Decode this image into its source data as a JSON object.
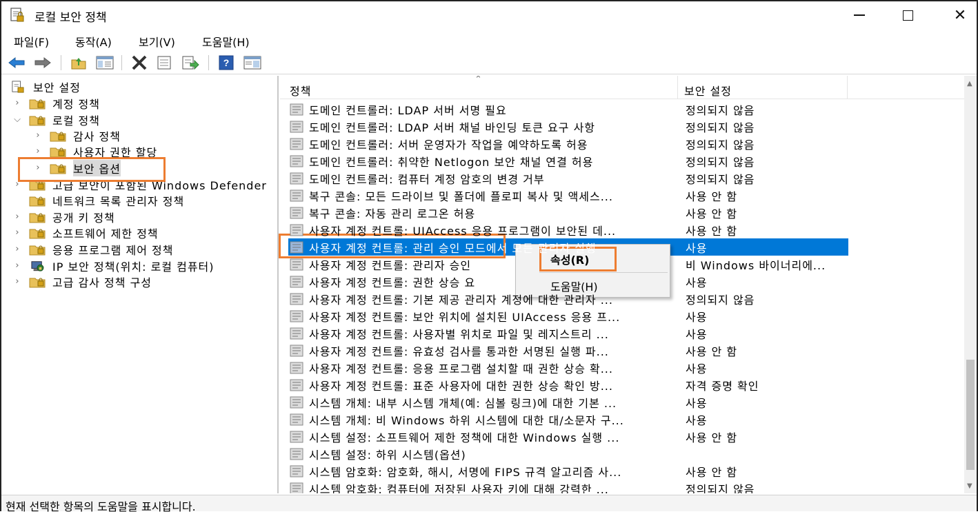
{
  "window": {
    "title": "로컬 보안 정책"
  },
  "menu": [
    "파일(F)",
    "동작(A)",
    "보기(V)",
    "도움말(H)"
  ],
  "toolbar": {
    "icons": [
      "back-arrow-icon",
      "forward-arrow-icon",
      "up-folder-icon",
      "show-hide-tree-icon",
      "delete-icon",
      "properties-icon",
      "export-list-icon",
      "help-icon",
      "console-icon"
    ]
  },
  "tree": [
    {
      "label": "보안 설정",
      "level": 0,
      "chevron": "",
      "icon": "security-settings-icon"
    },
    {
      "label": "계정 정책",
      "level": 1,
      "chevron": ">",
      "icon": "folder-icon"
    },
    {
      "label": "로컬 정책",
      "level": 1,
      "chevron": "v",
      "icon": "folder-icon"
    },
    {
      "label": "감사 정책",
      "level": 2,
      "chevron": ">",
      "icon": "folder-icon"
    },
    {
      "label": "사용자 권한 할당",
      "level": 2,
      "chevron": ">",
      "icon": "folder-icon"
    },
    {
      "label": "보안 옵션",
      "level": 2,
      "chevron": ">",
      "icon": "folder-icon",
      "selected": true
    },
    {
      "label": "고급 보안이 포함된 Windows Defender",
      "level": 1,
      "chevron": ">",
      "icon": "folder-icon"
    },
    {
      "label": "네트워크 목록 관리자 정책",
      "level": 1,
      "chevron": "",
      "icon": "folder-icon"
    },
    {
      "label": "공개 키 정책",
      "level": 1,
      "chevron": ">",
      "icon": "folder-icon"
    },
    {
      "label": "소프트웨어 제한 정책",
      "level": 1,
      "chevron": ">",
      "icon": "folder-icon"
    },
    {
      "label": "응용 프로그램 제어 정책",
      "level": 1,
      "chevron": ">",
      "icon": "folder-icon"
    },
    {
      "label": "IP 보안 정책(위치: 로컬 컴퓨터)",
      "level": 1,
      "chevron": ">",
      "icon": "ip-security-icon"
    },
    {
      "label": "고급 감사 정책 구성",
      "level": 1,
      "chevron": ">",
      "icon": "folder-icon"
    }
  ],
  "list": {
    "columns": {
      "policy": "정책",
      "setting": "보안 설정"
    },
    "rows": [
      {
        "policy": "도메인 컨트롤러: LDAP 서버 서명 필요",
        "setting": "정의되지 않음"
      },
      {
        "policy": "도메인 컨트롤러: LDAP 서버 채널 바인딩 토큰 요구 사항",
        "setting": "정의되지 않음"
      },
      {
        "policy": "도메인 컨트롤러: 서버 운영자가 작업을 예약하도록 허용",
        "setting": "정의되지 않음"
      },
      {
        "policy": "도메인 컨트롤러: 취약한 Netlogon 보안 채널 연결 허용",
        "setting": "정의되지 않음"
      },
      {
        "policy": "도메인 컨트롤러: 컴퓨터 계정 암호의 변경 거부",
        "setting": "정의되지 않음"
      },
      {
        "policy": "복구 콘솔: 모든 드라이브 및 폴더에 플로피 복사 및 액세스...",
        "setting": "사용 안 함"
      },
      {
        "policy": "복구 콘솔: 자동 관리 로그온 허용",
        "setting": "사용 안 함"
      },
      {
        "policy": "사용자 계정 컨트롤: UIAccess 응용 프로그램이 보안된 데...",
        "setting": "사용 안 함"
      },
      {
        "policy": "사용자 계정 컨트롤: 관리 승인 모드에서 모든 관리자 실행",
        "setting": "사용",
        "selected": true
      },
      {
        "policy": "사용자 계정 컨트롤: 관리자 승인",
        "setting": "비 Windows 바이너리에..."
      },
      {
        "policy": "사용자 계정 컨트롤: 권한 상승 요",
        "setting": "사용"
      },
      {
        "policy": "사용자 계정 컨트롤: 기본 제공 관리자 계정에 대한 관리자 ...",
        "setting": "정의되지 않음"
      },
      {
        "policy": "사용자 계정 컨트롤: 보안 위치에 설치된 UIAccess 응용 프...",
        "setting": "사용"
      },
      {
        "policy": "사용자 계정 컨트롤: 사용자별 위치로 파일 및 레지스트리 ...",
        "setting": "사용"
      },
      {
        "policy": "사용자 계정 컨트롤: 유효성 검사를 통과한 서명된 실행 파...",
        "setting": "사용 안 함"
      },
      {
        "policy": "사용자 계정 컨트롤: 응용 프로그램 설치할 때 권한 상승 확...",
        "setting": "사용"
      },
      {
        "policy": "사용자 계정 컨트롤: 표준 사용자에 대한 권한 상승 확인 방...",
        "setting": "자격 증명 확인"
      },
      {
        "policy": "시스템 개체: 내부 시스템 개체(예: 심볼 링크)에 대한 기본 ...",
        "setting": "사용"
      },
      {
        "policy": "시스템 개체: 비 Windows 하위 시스템에 대한 대/소문자 구...",
        "setting": "사용"
      },
      {
        "policy": "시스템 설정: 소프트웨어 제한 정책에 대한 Windows 실행 ...",
        "setting": "사용 안 함"
      },
      {
        "policy": "시스템 설정: 하위 시스템(옵션)",
        "setting": ""
      },
      {
        "policy": "시스템 암호화: 암호화, 해시, 서명에 FIPS 규격 알고리즘 사...",
        "setting": "사용 안 함"
      },
      {
        "policy": "시스템 암호화: 컴퓨터에 저장된 사용자 키에 대해 강력한 ...",
        "setting": "정의되지 않음"
      }
    ]
  },
  "context_menu": {
    "properties": "속성(R)",
    "help": "도움말(H)"
  },
  "status": "현재 선택한 항목의 도움말을 표시합니다.",
  "colors": {
    "selection": "#0078d7",
    "highlight_box": "#ed7d31",
    "folder": "#e8c15a"
  }
}
